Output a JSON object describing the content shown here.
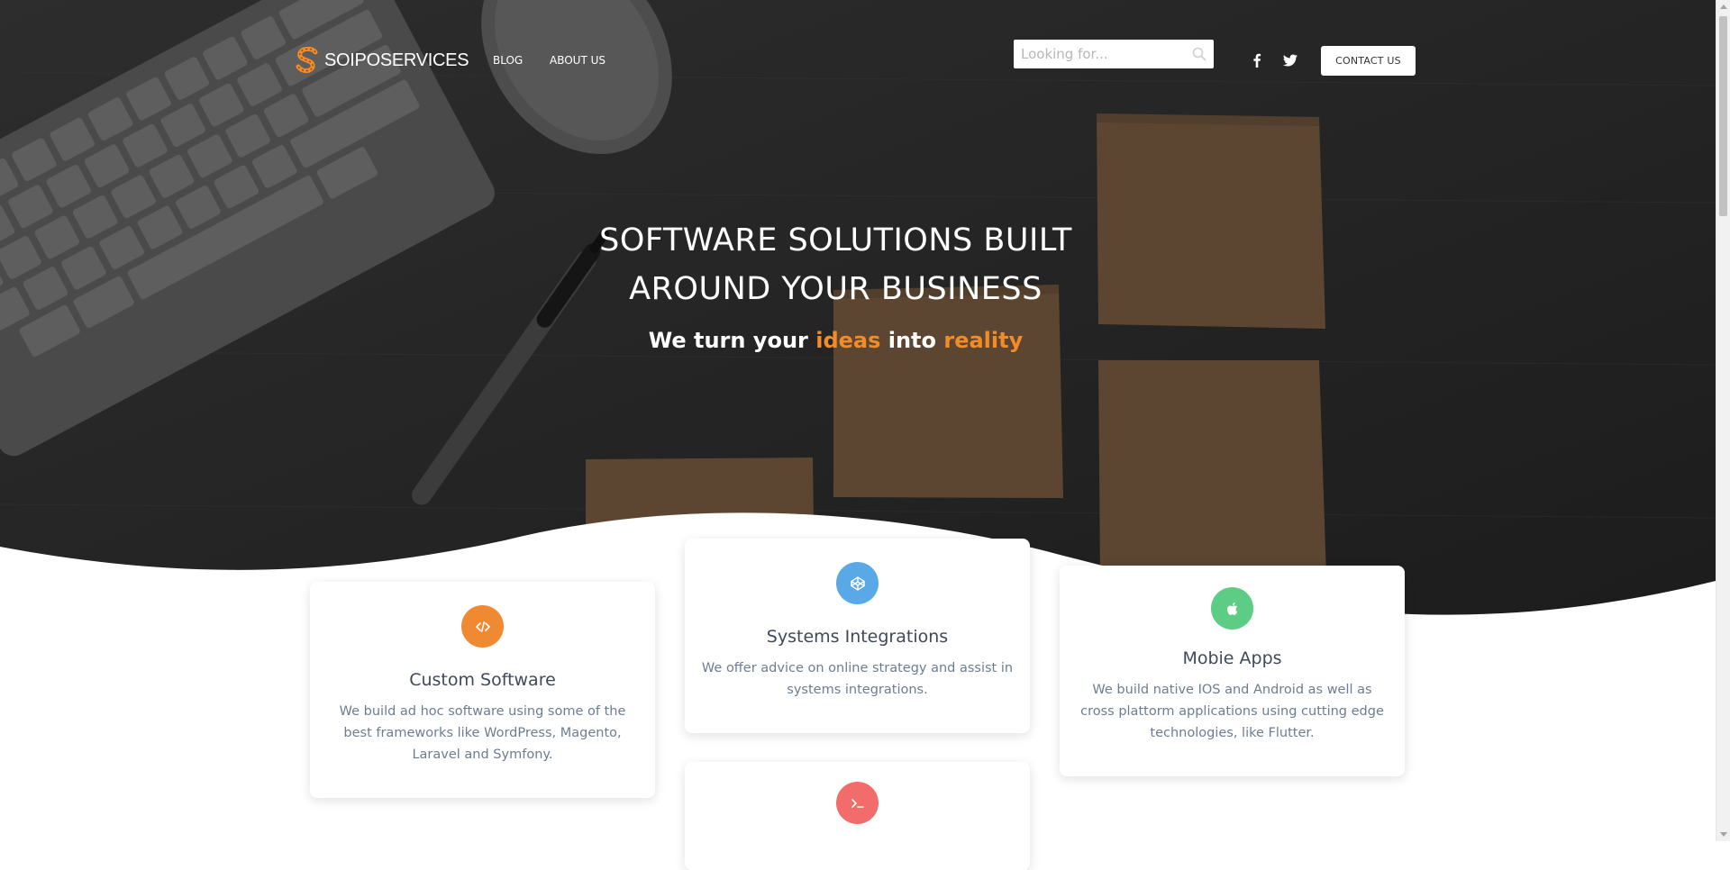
{
  "header": {
    "logo_text": "SOIPOSERVICES",
    "nav": [
      "BLOG",
      "ABOUT US"
    ],
    "search_placeholder": "Looking for...",
    "contact_label": "CONTACT US"
  },
  "hero": {
    "title_line1": "SOFTWARE SOLUTIONS BUILT",
    "title_line2": "AROUND YOUR BUSINESS",
    "sub": {
      "part1": "We turn your ",
      "word1": "ideas",
      "part2": " into ",
      "word2": "reality"
    }
  },
  "services": [
    {
      "title": "Custom Software",
      "desc": "We build ad hoc software using some of the best frameworks like WordPress, Magento, Laravel and Symfony.",
      "icon": "code-icon",
      "color": "#ef8a32"
    },
    {
      "title": "Systems Integrations",
      "desc": "We offer advice on online strategy and assist in systems integrations.",
      "icon": "codepen-icon",
      "color": "#58a9e6"
    },
    {
      "title": "Mobie Apps",
      "desc": "We build native IOS and Android as well as cross plattorm applications using cutting edge technologies, like Flutter.",
      "icon": "apple-icon",
      "color": "#5dcc84"
    },
    {
      "title": "",
      "desc": "",
      "icon": "terminal-icon",
      "color": "#f36c6c"
    }
  ],
  "colors": {
    "accent": "#f28c28",
    "hero_bg": "#262626"
  }
}
